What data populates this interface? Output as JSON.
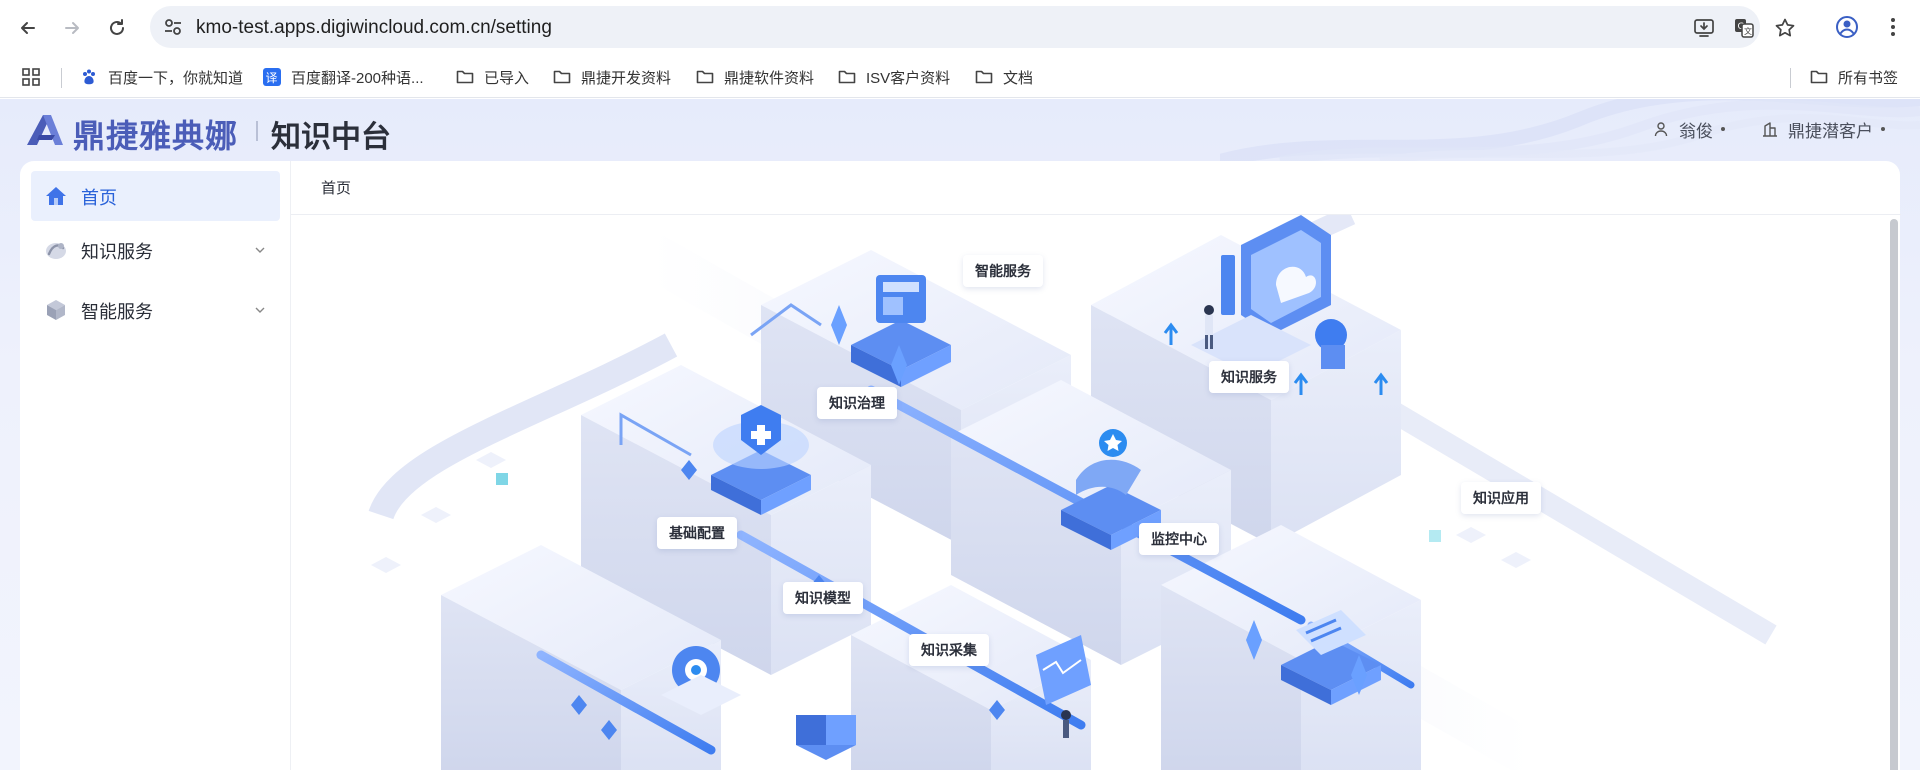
{
  "browser": {
    "url": "kmo-test.apps.digiwincloud.com.cn/setting",
    "bookmarks": [
      {
        "label": "百度一下，你就知道",
        "icon": "baidu-icon"
      },
      {
        "label": "百度翻译-200种语...",
        "icon": "translate-icon"
      },
      {
        "label": "已导入",
        "icon": "folder-icon"
      },
      {
        "label": "鼎捷开发资料",
        "icon": "folder-icon"
      },
      {
        "label": "鼎捷软件资料",
        "icon": "folder-icon"
      },
      {
        "label": "ISV客户资料",
        "icon": "folder-icon"
      },
      {
        "label": "文档",
        "icon": "folder-icon"
      }
    ],
    "all_bookmarks": "所有书签"
  },
  "app": {
    "brand": "鼎捷雅典娜",
    "title": "知识中台",
    "user_name": "翁俊",
    "tenant": "鼎捷潜客户"
  },
  "sidebar": {
    "items": [
      {
        "label": "首页",
        "icon": "home-icon",
        "active": true
      },
      {
        "label": "知识服务",
        "icon": "knowledge-service-icon",
        "expandable": true
      },
      {
        "label": "智能服务",
        "icon": "cube-icon",
        "expandable": true
      }
    ]
  },
  "content": {
    "breadcrumb": "首页",
    "illustration_labels": {
      "smart_service": "智能服务",
      "knowledge_service": "知识服务",
      "knowledge_governance": "知识治理",
      "knowledge_application": "知识应用",
      "basic_config": "基础配置",
      "monitor_center": "监控中心",
      "knowledge_model": "知识模型",
      "knowledge_collection": "知识采集"
    }
  },
  "colors": {
    "accent": "#2962d9",
    "brand": "#4b5db8",
    "active_bg": "#eaf0fd"
  }
}
